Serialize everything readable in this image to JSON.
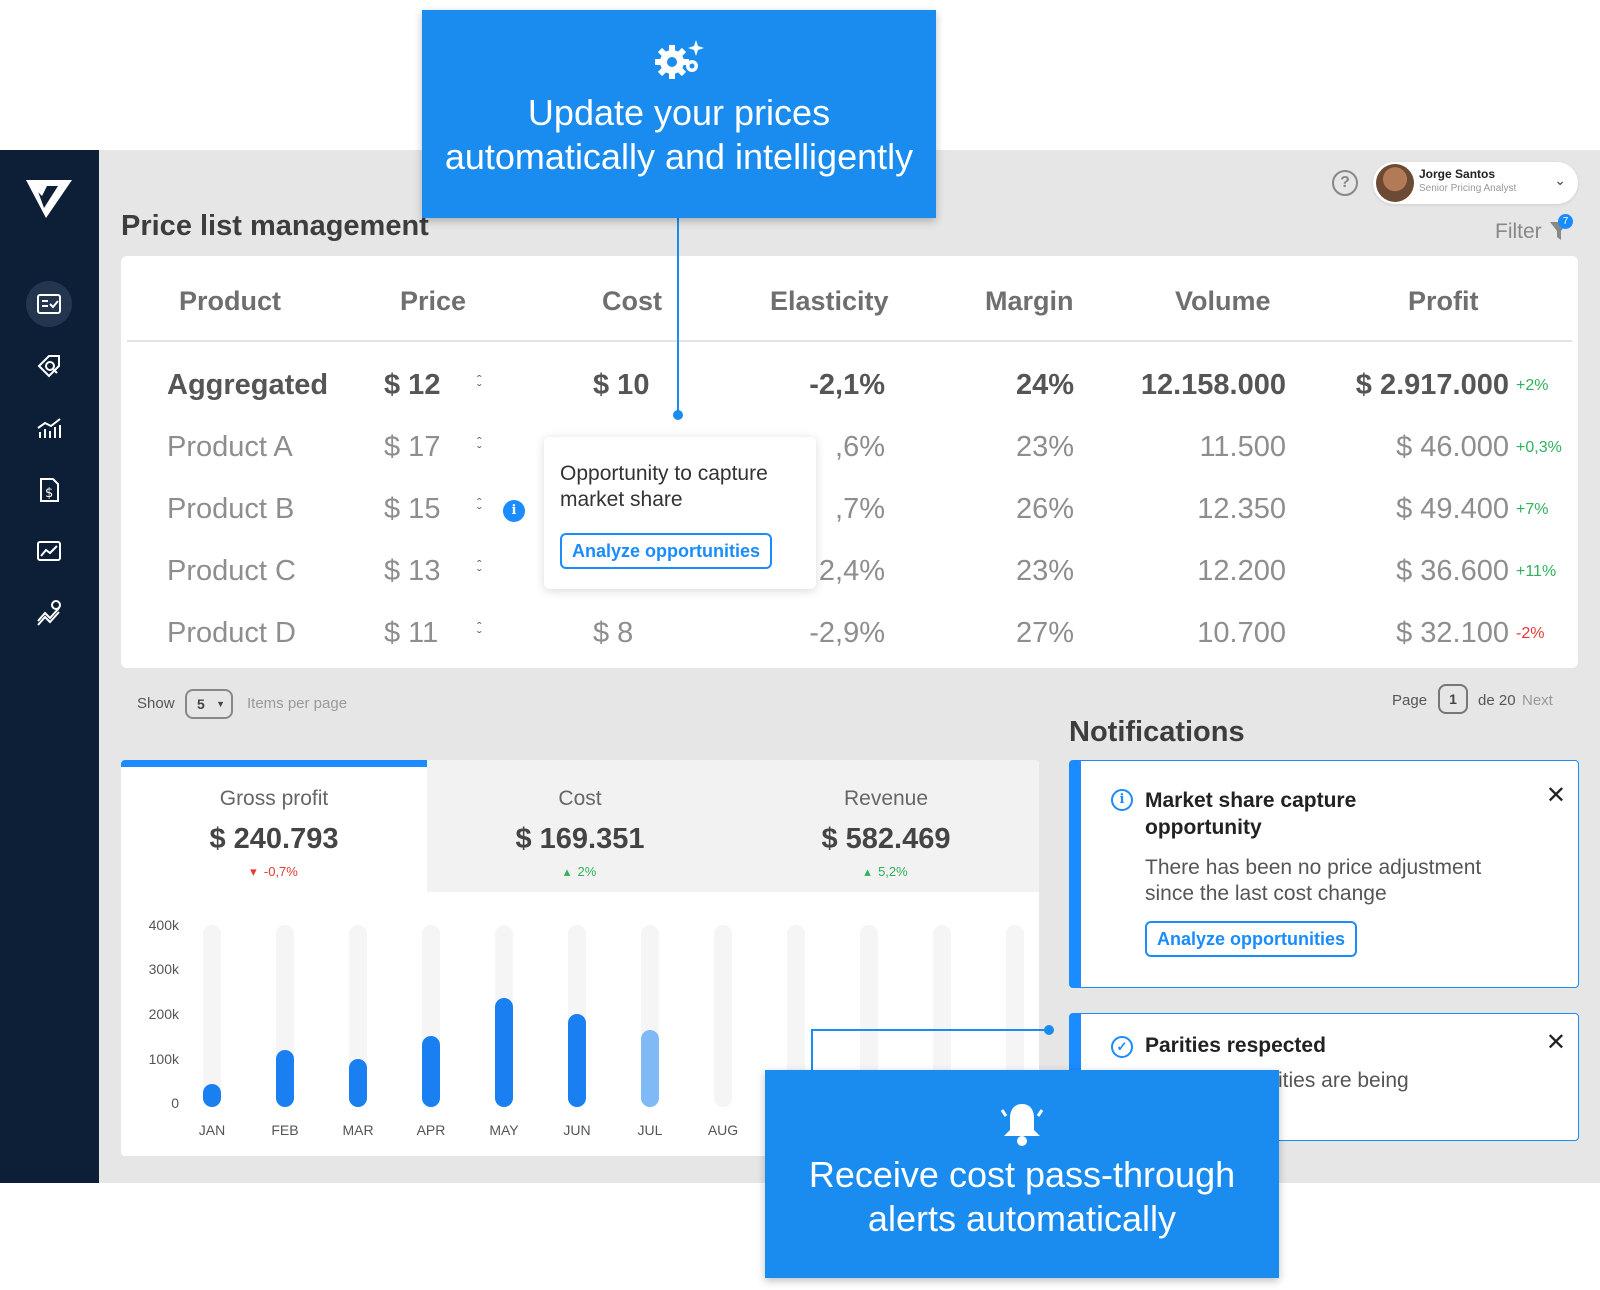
{
  "callouts": {
    "top": {
      "line1": "Update your prices",
      "line2": "automatically and intelligently",
      "icon": "gears-icon"
    },
    "bottom": {
      "line1": "Receive cost pass-through",
      "line2": "alerts automatically",
      "icon": "bell-icon"
    }
  },
  "sidebar": {
    "items": [
      {
        "name": "price-list-icon",
        "active": true
      },
      {
        "name": "tag-search-icon",
        "active": false
      },
      {
        "name": "analytics-icon",
        "active": false
      },
      {
        "name": "invoice-icon",
        "active": false
      },
      {
        "name": "chart-image-icon",
        "active": false
      },
      {
        "name": "trend-icon",
        "active": false
      }
    ]
  },
  "header": {
    "title": "Price list management",
    "help": "?",
    "user": {
      "name": "Jorge Santos",
      "role": "Senior Pricing Analyst"
    },
    "filter_label": "Filter",
    "filter_badge": "7"
  },
  "table": {
    "columns": [
      "Product",
      "Price",
      "Cost",
      "Elasticity",
      "Margin",
      "Volume",
      "Profit"
    ],
    "aggregated": {
      "product": "Aggregated",
      "price": "$ 12",
      "cost": "$ 10",
      "elasticity": "-2,1%",
      "margin": "24%",
      "volume": "12.158.000",
      "profit": "$ 2.917.000",
      "delta": "+2%"
    },
    "rows": [
      {
        "product": "Product A",
        "price": "$ 17",
        "cost": "",
        "elasticity": ",6%",
        "margin": "23%",
        "volume": "11.500",
        "profit": "$ 46.000",
        "delta": "+0,3%"
      },
      {
        "product": "Product B",
        "price": "$ 15",
        "cost": "",
        "elasticity": ",7%",
        "margin": "26%",
        "volume": "12.350",
        "profit": "$ 49.400",
        "delta": "+7%"
      },
      {
        "product": "Product C",
        "price": "$ 13",
        "cost": "",
        "elasticity": "2,4%",
        "margin": "23%",
        "volume": "12.200",
        "profit": "$ 36.600",
        "delta": "+11%"
      },
      {
        "product": "Product D",
        "price": "$ 11",
        "cost": "$ 8",
        "elasticity": "-2,9%",
        "margin": "27%",
        "volume": "10.700",
        "profit": "$ 32.100",
        "delta": "-2%"
      }
    ]
  },
  "tooltip": {
    "text": "Opportunity to capture market share",
    "button": "Analyze opportunities",
    "info": "i"
  },
  "pager": {
    "show": "Show",
    "per_page_value": "5",
    "per_page_label": "Items per page",
    "page_label": "Page",
    "page_value": "1",
    "of_label": "de 20",
    "next": "Next"
  },
  "notifications": {
    "title": "Notifications",
    "items": [
      {
        "title_line1": "Market share capture",
        "title_line2": "opportunity",
        "body_line1": "There has been no price adjustment",
        "body_line2": "since the last cost change",
        "button": "Analyze opportunities",
        "icon": "info-icon"
      },
      {
        "title_line1": "Parities respected",
        "body_line1": "rities are being",
        "icon": "check-circle-icon"
      }
    ]
  },
  "kpis": [
    {
      "label": "Gross profit",
      "value": "$ 240.793",
      "delta": "-0,7%",
      "direction": "down"
    },
    {
      "label": "Cost",
      "value": "$ 169.351",
      "delta": "2%",
      "direction": "up"
    },
    {
      "label": "Revenue",
      "value": "$ 582.469",
      "delta": "5,2%",
      "direction": "up"
    }
  ],
  "chart_data": {
    "type": "bar",
    "categories": [
      "JAN",
      "FEB",
      "MAR",
      "APR",
      "MAY",
      "JUN",
      "JUL",
      "AUG"
    ],
    "values": [
      50000,
      125000,
      105000,
      155000,
      240000,
      205000,
      170000,
      null
    ],
    "yticks": [
      "400k",
      "300k",
      "200k",
      "100k",
      "0"
    ],
    "ylim": [
      0,
      400000
    ],
    "highlight_color": "#1a7ff0",
    "projected_color": "#7fbaf7"
  }
}
